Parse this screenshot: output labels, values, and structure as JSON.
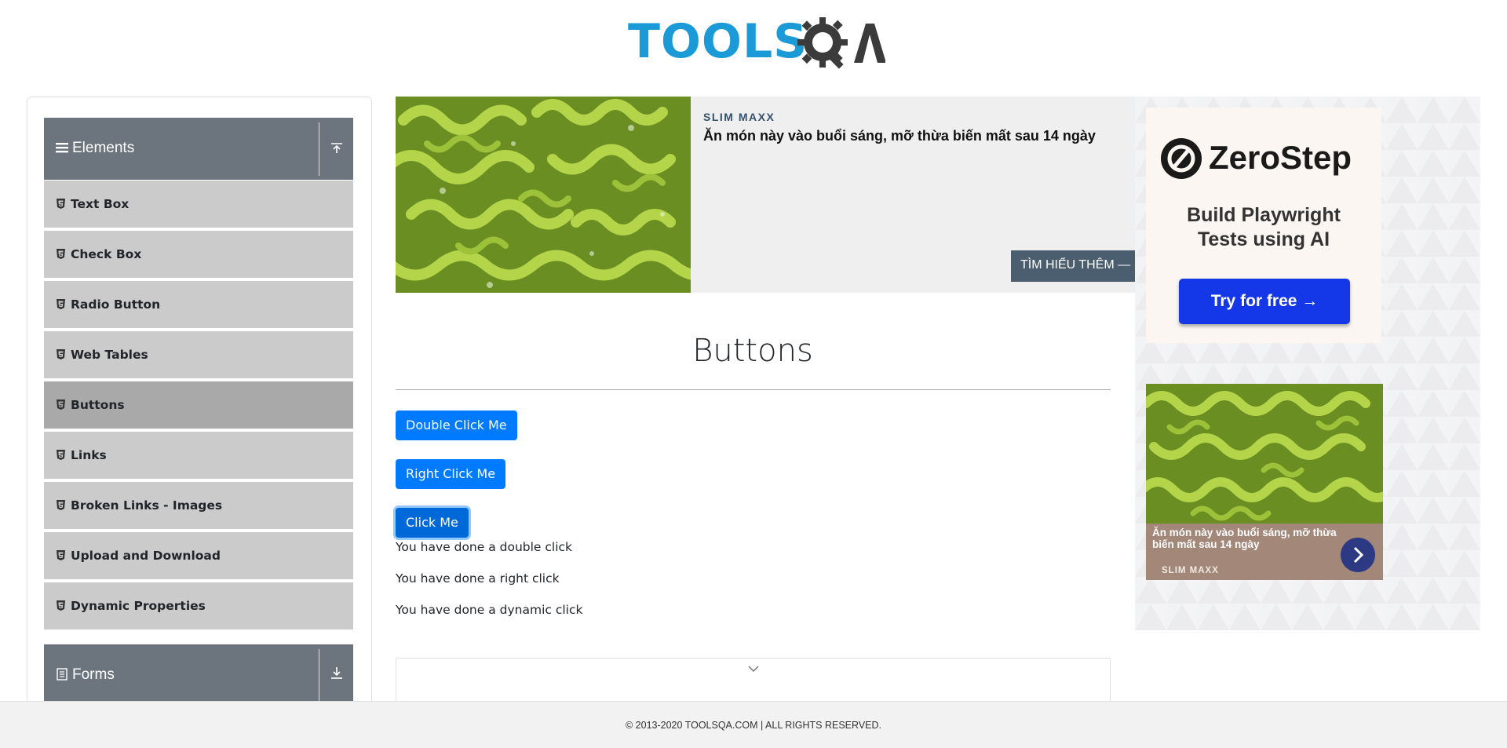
{
  "header": {
    "logo_tools": "TOOLS",
    "logo_qa": "QA"
  },
  "sidebar": {
    "groups": [
      {
        "label": "Elements",
        "icon": "hamburger-icon",
        "toggle_icon": "collapse-up-icon"
      },
      {
        "label": "Forms",
        "icon": "document-icon",
        "toggle_icon": "expand-down-icon"
      }
    ],
    "items": [
      {
        "label": "Text Box"
      },
      {
        "label": "Check Box"
      },
      {
        "label": "Radio Button"
      },
      {
        "label": "Web Tables"
      },
      {
        "label": "Buttons",
        "active": true
      },
      {
        "label": "Links"
      },
      {
        "label": "Broken Links - Images"
      },
      {
        "label": "Upload and Download"
      },
      {
        "label": "Dynamic Properties"
      }
    ]
  },
  "ad_top": {
    "brand": "SLIM MAXX",
    "headline": "Ăn món này vào buổi sáng, mỡ thừa biến mất sau 14 ngày",
    "cta": "TÌM HIỂU THÊM —"
  },
  "ad_right": {
    "zerostep_name": "ZeroStep",
    "zerostep_tagline_1": "Build Playwright",
    "zerostep_tagline_2": "Tests using AI",
    "zerostep_button": "Try for free →",
    "native_headline": "Ăn món này vào buổi sáng, mỡ thừa biến mất sau 14 ngày",
    "native_brand": "SLIM MAXX"
  },
  "main": {
    "title": "Buttons",
    "buttons": {
      "double_click": "Double Click Me",
      "right_click": "Right Click Me",
      "click": "Click Me"
    },
    "messages": {
      "double": "You have done a double click",
      "right": "You have done a right click",
      "dynamic": "You have done a dynamic click"
    }
  },
  "footer": {
    "text": "© 2013-2020 TOOLSQA.COM | ALL RIGHTS RESERVED."
  },
  "colors": {
    "primary": "#007bff",
    "sidebar_header": "#6c757d",
    "menu_item": "#cbcbcb",
    "menu_item_active": "#a9a9a9",
    "logo_blue": "#1a9ad6",
    "zerostep_blue": "#1438e8"
  }
}
